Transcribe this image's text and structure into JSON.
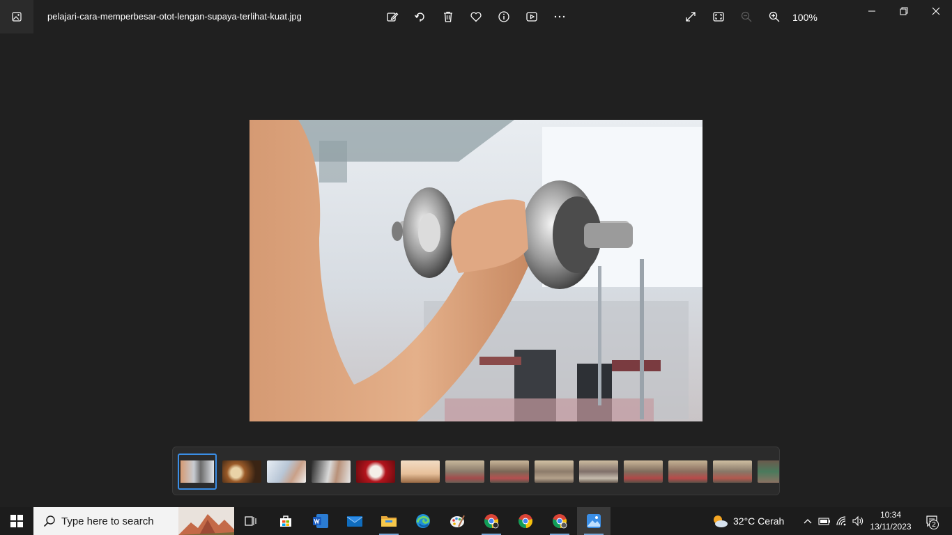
{
  "titlebar": {
    "filename": "pelajari-cara-memperbesar-otot-lengan-supaya-terlihat-kuat.jpg",
    "zoom": "100%",
    "tools": [
      "edit-icon",
      "rotate-icon",
      "delete-icon",
      "favorite-icon",
      "info-icon",
      "slideshow-icon",
      "more-icon"
    ],
    "view_tools": [
      "fullscreen-icon",
      "fit-to-window-icon",
      "zoom-out-icon",
      "zoom-in-icon"
    ]
  },
  "filmstrip": {
    "count": 14,
    "selected_index": 0
  },
  "taskbar": {
    "search_placeholder": "Type here to search",
    "weather": "32°C  Cerah",
    "time": "10:34",
    "date": "13/11/2023",
    "notifications": "2",
    "apps": [
      "task-view",
      "microsoft-store",
      "word",
      "mail",
      "file-explorer",
      "edge",
      "paint",
      "chrome-profile-1",
      "chrome",
      "chrome-profile-2",
      "photos"
    ]
  }
}
